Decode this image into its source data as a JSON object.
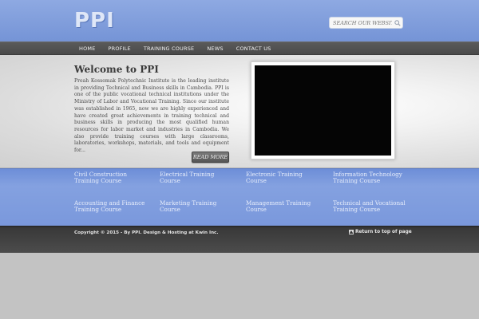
{
  "header": {
    "logo": "PPI",
    "search_placeholder": "SEARCH OUR WEBSITE..."
  },
  "nav": {
    "items": [
      "HOME",
      "PROFILE",
      "TRAINING COURSE",
      "NEWS",
      "CONTACT US"
    ]
  },
  "main": {
    "title": "Welcome to PPI",
    "intro": "Preah Kossomak Polytechnic Institute is the leading institute in providing Technical and Business skills in Cambodia. PPI is one of the public vocational technical institutions under the Ministry of Labor and Vocational Training. Since our institute was established in 1965, now we are highly experienced and  have created great achievements in training technical and business skills in  producing the most qualified human resources for labor market and industries in Cambodia. We also provide training courses with large classrooms, laboratories, workshops, materials, and tools and equipment for...",
    "read_more": "READ MORE"
  },
  "courses": {
    "items": [
      {
        "line1": "Civil Construction",
        "line2": "Training Course"
      },
      {
        "line1": "Electrical Training",
        "line2": "Course"
      },
      {
        "line1": "Electronic Training",
        "line2": "Course"
      },
      {
        "line1": "Information Technology",
        "line2": "Training Course"
      },
      {
        "line1": "Accounting and Finance",
        "line2": "Training Course"
      },
      {
        "line1": "Marketing Training",
        "line2": "Course"
      },
      {
        "line1": "Management Training",
        "line2": "Course"
      },
      {
        "line1": "Technical and Vocational",
        "line2": "Training Course"
      }
    ]
  },
  "footer": {
    "copyright": "Copyright © 2015 - By PPI. Design & Hosting at Kwin Inc.",
    "top_link": "Return to top of page"
  },
  "colors": {
    "header_blue": "#7f9ddc",
    "nav_dark": "#4f4f4f",
    "footer_dark": "#3e3e3e"
  }
}
